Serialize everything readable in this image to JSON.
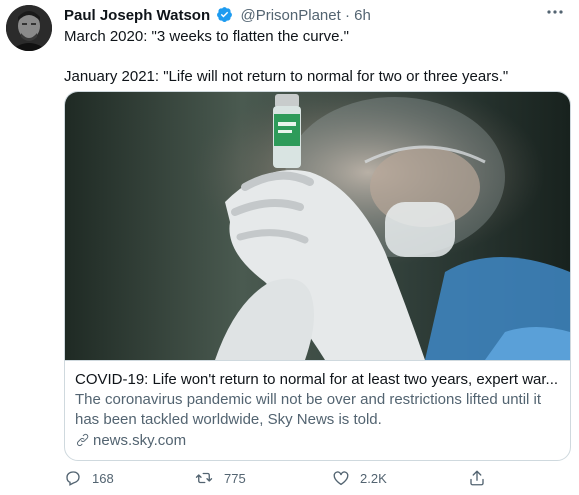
{
  "author": {
    "name": "Paul Joseph Watson",
    "handle": "@PrisonPlanet",
    "separator": "·",
    "time": "6h"
  },
  "tweet": {
    "line1": "March 2020: \"3 weeks to flatten the curve.\"",
    "line2": "January 2021: \"Life will not return to normal for two or three years.\""
  },
  "card": {
    "title": "COVID-19: Life won't return to normal for at least two years, expert war...",
    "description": "The coronavirus pandemic will not be over and restrictions lifted until it has been tackled worldwide, Sky News is told.",
    "domain": "news.sky.com"
  },
  "actions": {
    "reply_count": "168",
    "retweet_count": "775",
    "like_count": "2.2K"
  },
  "icons": [
    "verified-icon",
    "more-icon",
    "link-icon",
    "reply-icon",
    "retweet-icon",
    "like-icon",
    "share-icon"
  ],
  "colors": {
    "verified": "#1d9bf0",
    "secondary_text": "#536471",
    "border": "#cfd9de"
  }
}
